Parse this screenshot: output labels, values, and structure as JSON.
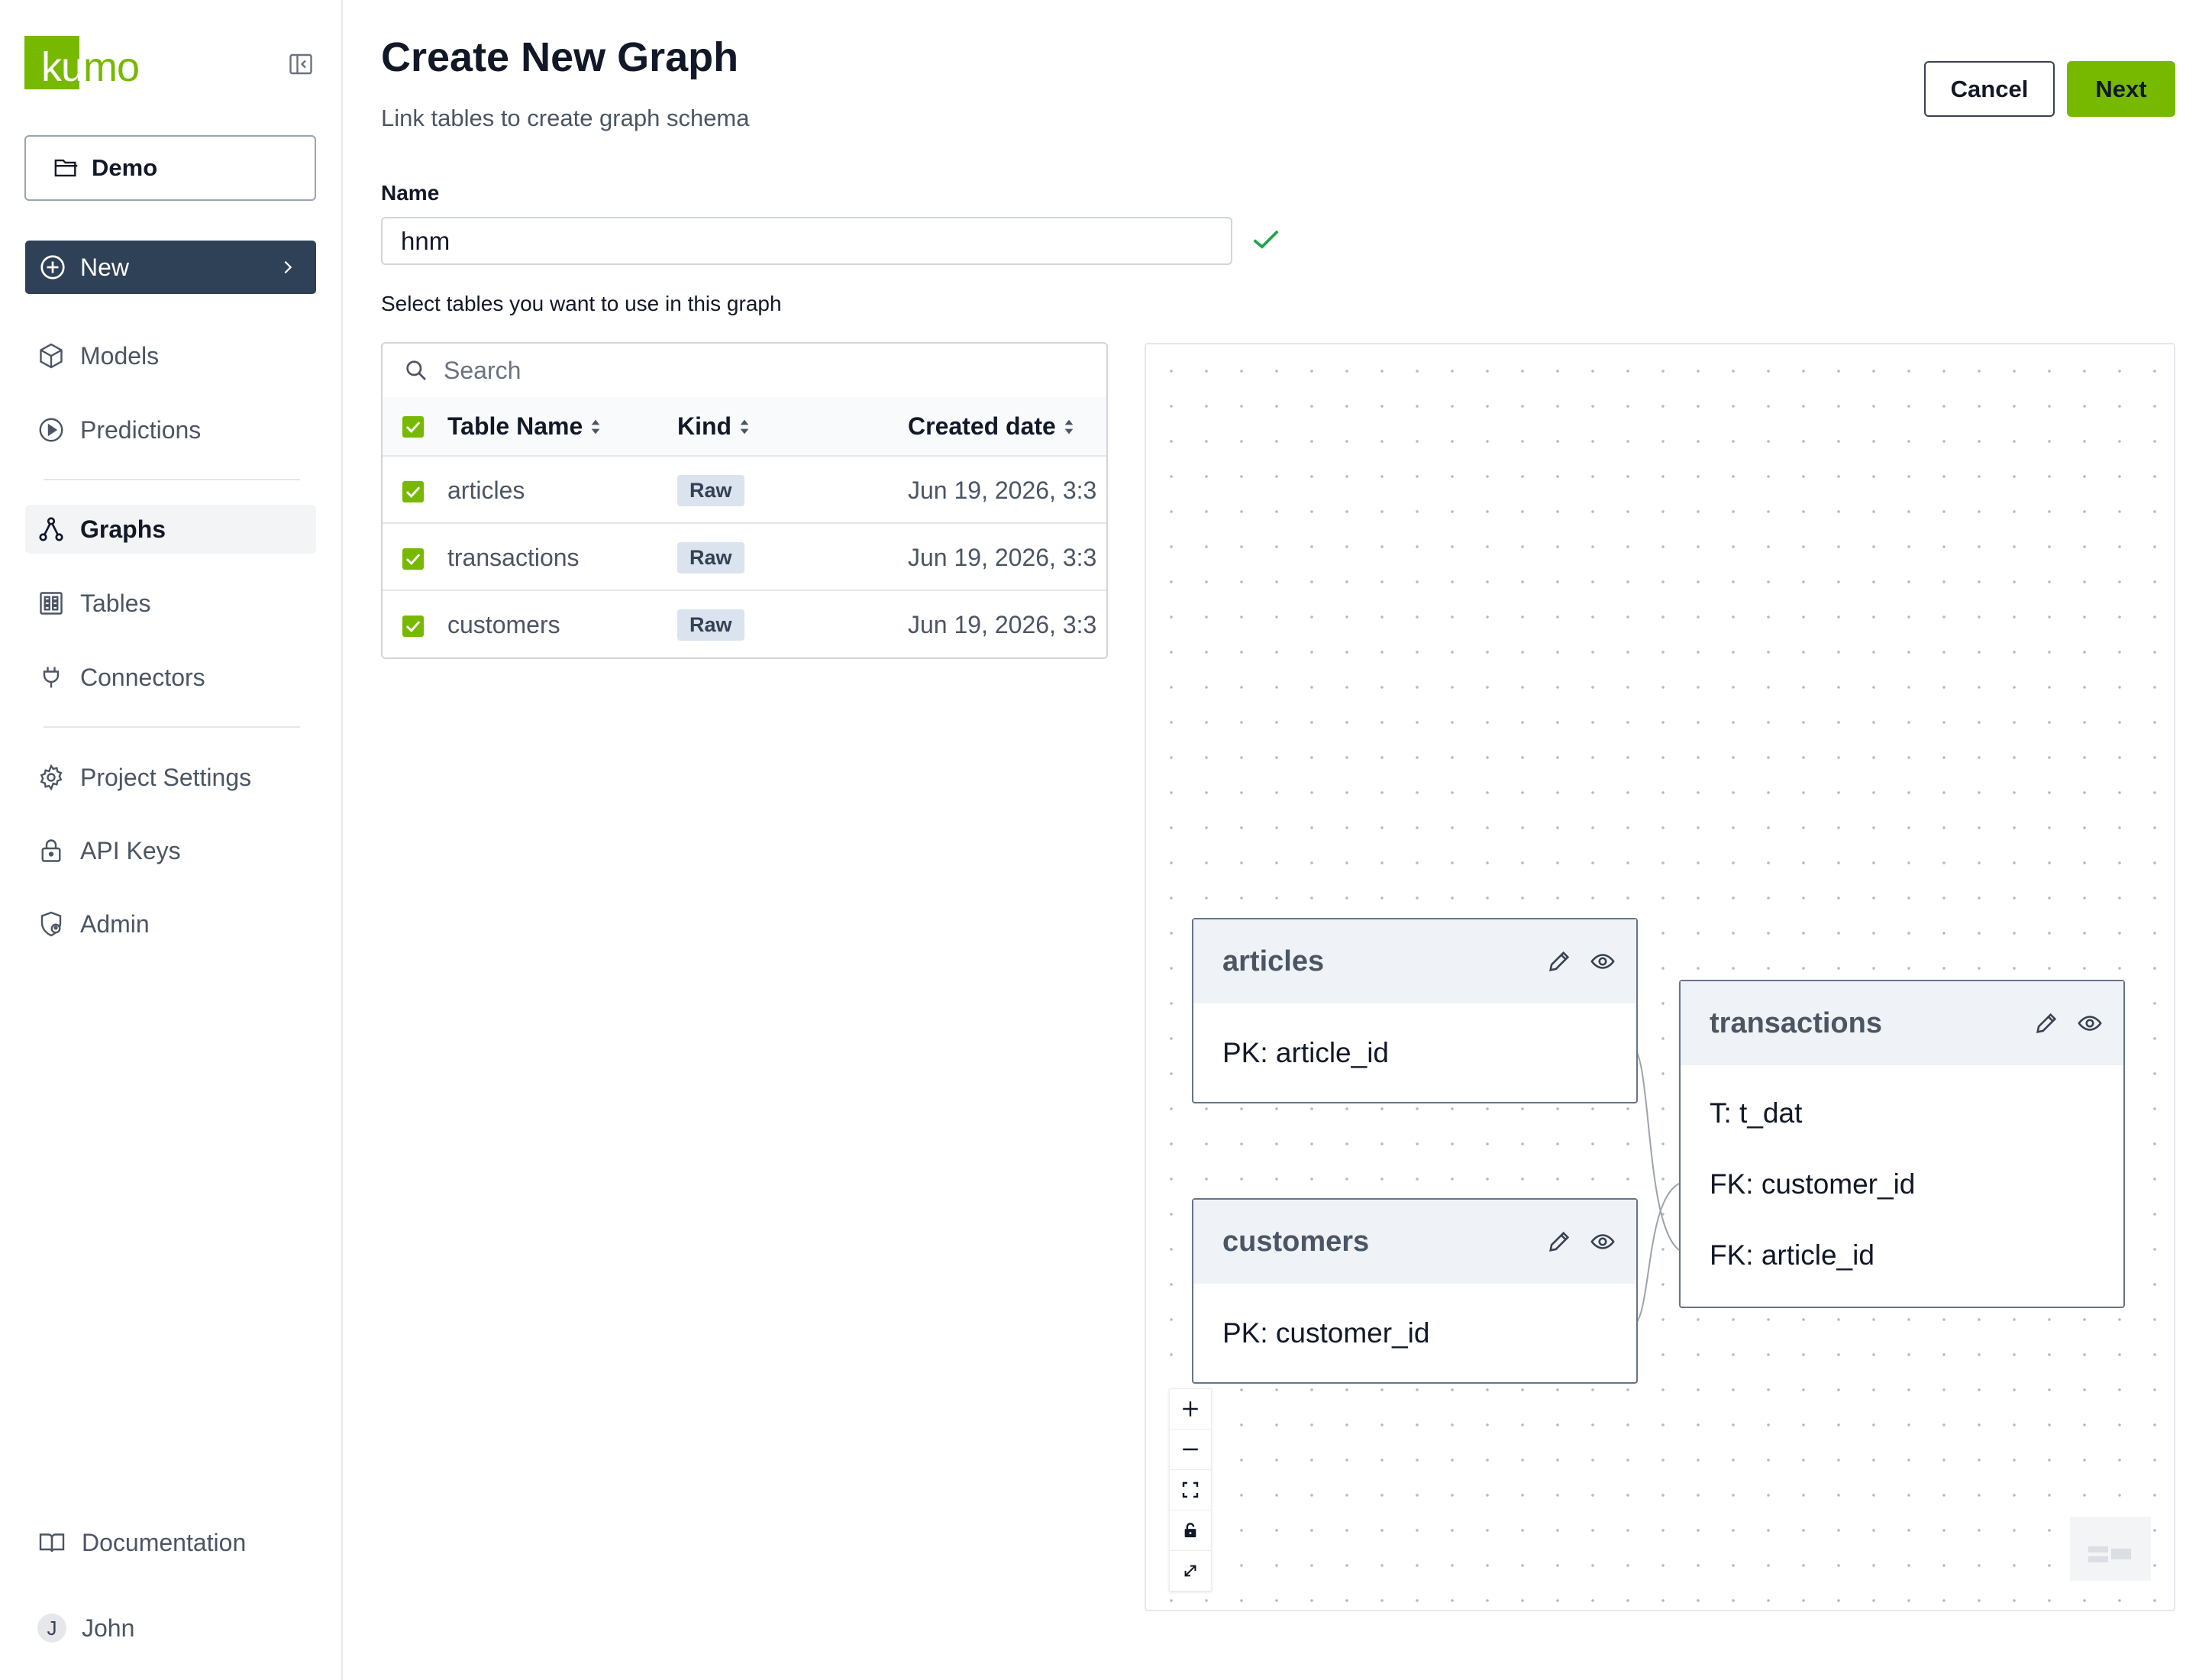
{
  "app": {
    "logo_text_1": "k",
    "logo_text_2": "u",
    "logo_text_3": "mo"
  },
  "sidebar": {
    "project": "Demo",
    "new_label": "New",
    "items": [
      {
        "label": "Models",
        "icon": "cube-icon"
      },
      {
        "label": "Predictions",
        "icon": "play-circle-icon"
      },
      {
        "label": "Graphs",
        "icon": "graph-icon",
        "active": true
      },
      {
        "label": "Tables",
        "icon": "table-grid-icon"
      },
      {
        "label": "Connectors",
        "icon": "plug-icon"
      },
      {
        "label": "Project Settings",
        "icon": "gear-icon"
      },
      {
        "label": "API Keys",
        "icon": "lock-icon"
      },
      {
        "label": "Admin",
        "icon": "shield-user-icon"
      }
    ],
    "documentation": "Documentation",
    "user": {
      "initial": "J",
      "name": "John"
    }
  },
  "header": {
    "title": "Create New Graph",
    "subtitle": "Link tables to create graph schema",
    "cancel_label": "Cancel",
    "next_label": "Next"
  },
  "form": {
    "name_label": "Name",
    "name_value": "hnm",
    "select_hint": "Select tables you want to use in this graph"
  },
  "table": {
    "search_placeholder": "Search",
    "columns": [
      "Table Name",
      "Kind",
      "Created date"
    ],
    "rows": [
      {
        "name": "articles",
        "kind": "Raw",
        "created": "Jun 19, 2026, 3:3",
        "checked": true
      },
      {
        "name": "transactions",
        "kind": "Raw",
        "created": "Jun 19, 2026, 3:3",
        "checked": true
      },
      {
        "name": "customers",
        "kind": "Raw",
        "created": "Jun 19, 2026, 3:3",
        "checked": true
      }
    ]
  },
  "graph": {
    "nodes": [
      {
        "name": "articles",
        "rows": [
          "PK: article_id"
        ]
      },
      {
        "name": "customers",
        "rows": [
          "PK: customer_id"
        ]
      },
      {
        "name": "transactions",
        "rows": [
          "T: t_dat",
          "FK: customer_id",
          "FK: article_id"
        ]
      }
    ],
    "edges": [
      {
        "from": "articles.PK: article_id",
        "to": "transactions.FK: article_id"
      },
      {
        "from": "customers.PK: customer_id",
        "to": "transactions.FK: customer_id"
      }
    ],
    "controls": [
      "zoom-in-icon",
      "zoom-out-icon",
      "fit-view-icon",
      "lock-icon",
      "expand-icon"
    ]
  },
  "colors": {
    "brand": "#76b900",
    "nav_dark": "#2f4157",
    "node_border": "#66748a",
    "badge_bg": "#dbe3ee"
  }
}
